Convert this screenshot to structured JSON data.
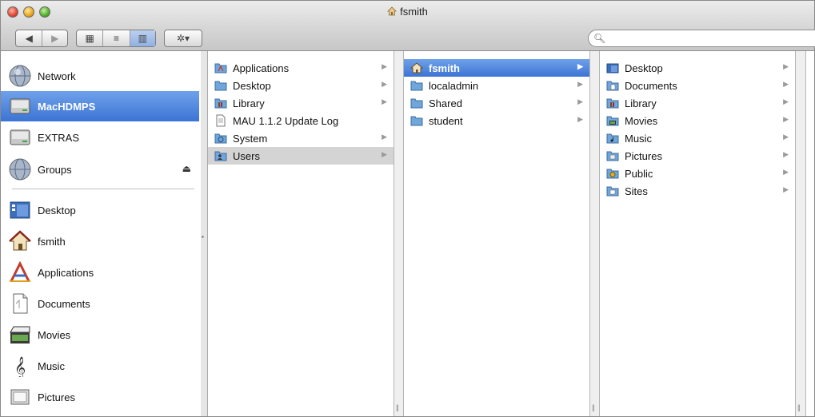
{
  "window": {
    "title": "fsmith",
    "title_icon": "home-icon"
  },
  "toolbar": {
    "back_icon": "back-arrow-icon",
    "forward_icon": "forward-arrow-icon",
    "view_icons": [
      "icon-view-icon",
      "list-view-icon",
      "column-view-icon"
    ],
    "action_icon": "gear-icon",
    "search": {
      "value": "",
      "placeholder": ""
    }
  },
  "sidebar": {
    "devices": [
      {
        "label": "Network",
        "icon": "network-globe-icon"
      },
      {
        "label": "MacHDMPS",
        "icon": "hard-drive-icon",
        "selected": true
      },
      {
        "label": "EXTRAS",
        "icon": "hard-drive-icon"
      },
      {
        "label": "Groups",
        "icon": "network-globe-icon",
        "eject": "⏏"
      }
    ],
    "places": [
      {
        "label": "Desktop",
        "icon": "desktop-icon"
      },
      {
        "label": "fsmith",
        "icon": "home-icon"
      },
      {
        "label": "Applications",
        "icon": "applications-icon"
      },
      {
        "label": "Documents",
        "icon": "documents-icon"
      },
      {
        "label": "Movies",
        "icon": "movies-icon"
      },
      {
        "label": "Music",
        "icon": "music-icon"
      },
      {
        "label": "Pictures",
        "icon": "pictures-icon"
      }
    ]
  },
  "columns": [
    {
      "items": [
        {
          "label": "Applications",
          "arrow": "▶"
        },
        {
          "label": "Desktop",
          "arrow": "▶"
        },
        {
          "label": "Library",
          "arrow": "▶"
        },
        {
          "label": "MAU 1.1.2 Update Log",
          "arrow": ""
        },
        {
          "label": "System",
          "arrow": "▶"
        },
        {
          "label": "Users",
          "arrow": "▶",
          "state": "path"
        }
      ]
    },
    {
      "items": [
        {
          "label": "fsmith",
          "arrow": "▶",
          "state": "selected"
        },
        {
          "label": "localadmin",
          "arrow": "▶"
        },
        {
          "label": "Shared",
          "arrow": "▶"
        },
        {
          "label": "student",
          "arrow": "▶"
        }
      ]
    },
    {
      "items": [
        {
          "label": "Desktop",
          "arrow": "▶"
        },
        {
          "label": "Documents",
          "arrow": "▶"
        },
        {
          "label": "Library",
          "arrow": "▶"
        },
        {
          "label": "Movies",
          "arrow": "▶"
        },
        {
          "label": "Music",
          "arrow": "▶"
        },
        {
          "label": "Pictures",
          "arrow": "▶"
        },
        {
          "label": "Public",
          "arrow": "▶"
        },
        {
          "label": "Sites",
          "arrow": "▶"
        }
      ]
    }
  ],
  "colors": {
    "selection": "#3c74d4",
    "path_highlight": "#d4d4d4",
    "folder_blue": "#6fa6dc"
  }
}
